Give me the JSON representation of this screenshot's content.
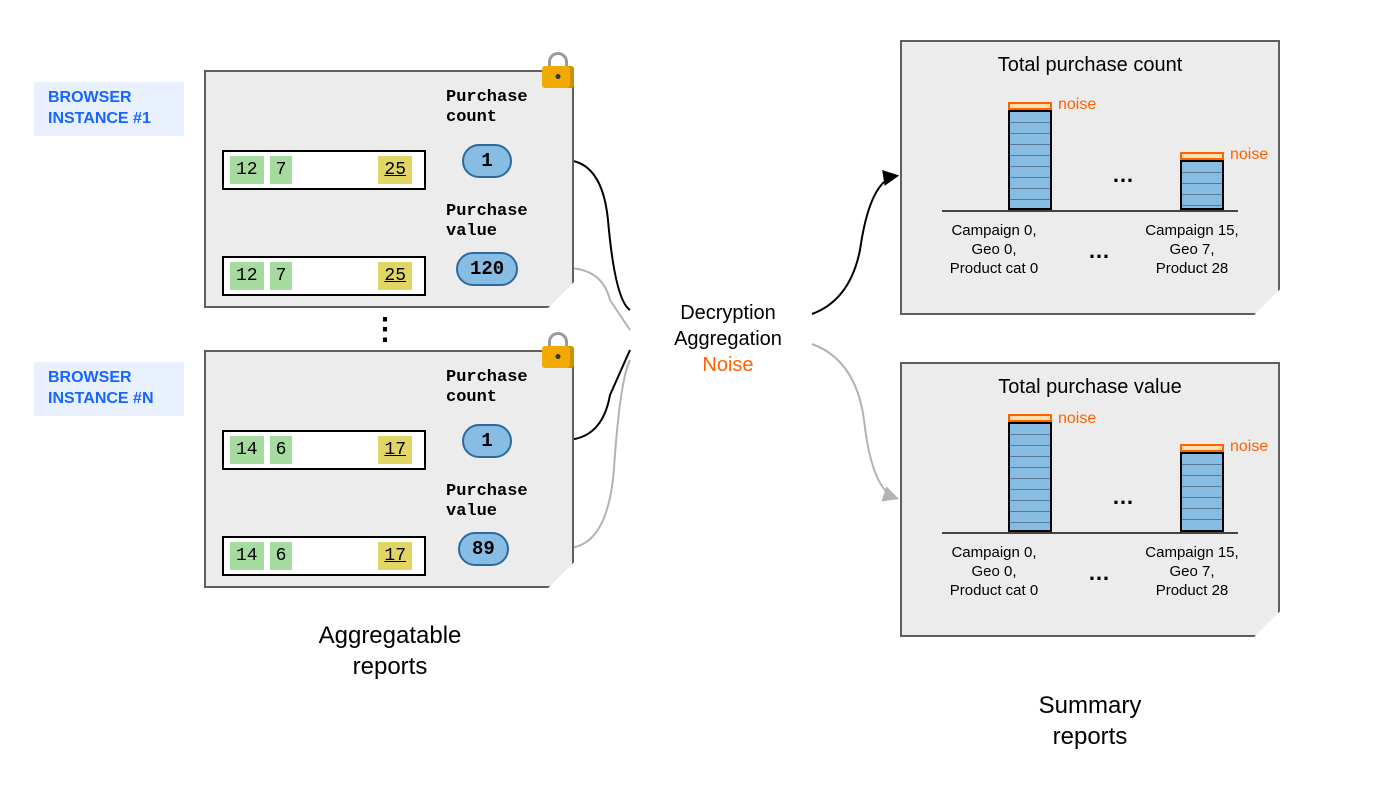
{
  "tags": {
    "browser1": "BROWSER INSTANCE #1",
    "browserN": "BROWSER INSTANCE #N"
  },
  "cards": {
    "c1": {
      "row1": [
        "12",
        "7",
        "25"
      ],
      "row2": [
        "12",
        "7",
        "25"
      ],
      "metric_count_label": "Purchase count",
      "metric_value_label": "Purchase value",
      "count": "1",
      "value": "120"
    },
    "c2": {
      "row1": [
        "14",
        "6",
        "17"
      ],
      "row2": [
        "14",
        "6",
        "17"
      ],
      "metric_count_label": "Purchase count",
      "metric_value_label": "Purchase value",
      "count": "1",
      "value": "89"
    }
  },
  "process": {
    "line1": "Decryption",
    "line2": "Aggregation",
    "noise": "Noise"
  },
  "summaries": {
    "s1": {
      "title": "Total purchase count",
      "noise_label": "noise",
      "hdots": "…",
      "axis_mid": "…",
      "axis1": "Campaign 0,\nGeo 0,\nProduct cat 0",
      "axis2": "Campaign 15,\nGeo 7,\nProduct 28"
    },
    "s2": {
      "title": "Total purchase value",
      "noise_label": "noise",
      "hdots": "…",
      "axis_mid": "…",
      "axis1": "Campaign 0,\nGeo 0,\nProduct cat 0",
      "axis2": "Campaign 15,\nGeo 7,\nProduct 28"
    }
  },
  "chart_data": [
    {
      "type": "bar",
      "title": "Total purchase count",
      "categories": [
        "Campaign 0, Geo 0, Product cat 0",
        "Campaign 15, Geo 7, Product 28"
      ],
      "values": [
        100,
        50
      ],
      "noise_indicator": true,
      "note": "values are relative bar heights; exact counts not shown in diagram"
    },
    {
      "type": "bar",
      "title": "Total purchase value",
      "categories": [
        "Campaign 0, Geo 0, Product cat 0",
        "Campaign 15, Geo 7, Product 28"
      ],
      "values": [
        110,
        80
      ],
      "noise_indicator": true,
      "note": "values are relative bar heights; exact values not shown in diagram"
    }
  ],
  "captions": {
    "aggregatable": "Aggregatable reports",
    "summary": "Summary reports"
  },
  "vdots": "⋮"
}
